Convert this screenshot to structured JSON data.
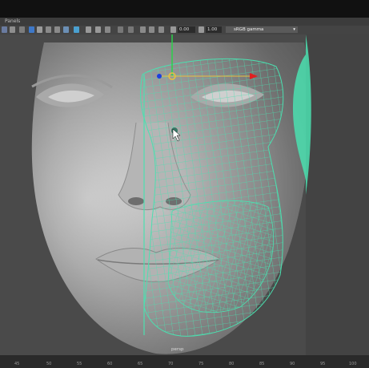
{
  "menubar": {
    "panels_label": "Panels"
  },
  "toolbar": {
    "exposure_value": "0.00",
    "gamma_value": "1.00",
    "colorspace_label": "sRGB gamma"
  },
  "viewport": {
    "camera_label": "persp"
  },
  "timeline": {
    "ticks": [
      "45",
      "50",
      "55",
      "60",
      "65",
      "70",
      "75",
      "80",
      "85",
      "90",
      "95",
      "100"
    ]
  },
  "colors": {
    "wireframe": "#4be0b0",
    "skin": "#c9c9c9",
    "background": "#4a4a4a",
    "manip_red": "#e02020",
    "manip_blue": "#1b3fe0",
    "manip_green": "#2bd04a",
    "manip_yellow": "#e8c040"
  }
}
